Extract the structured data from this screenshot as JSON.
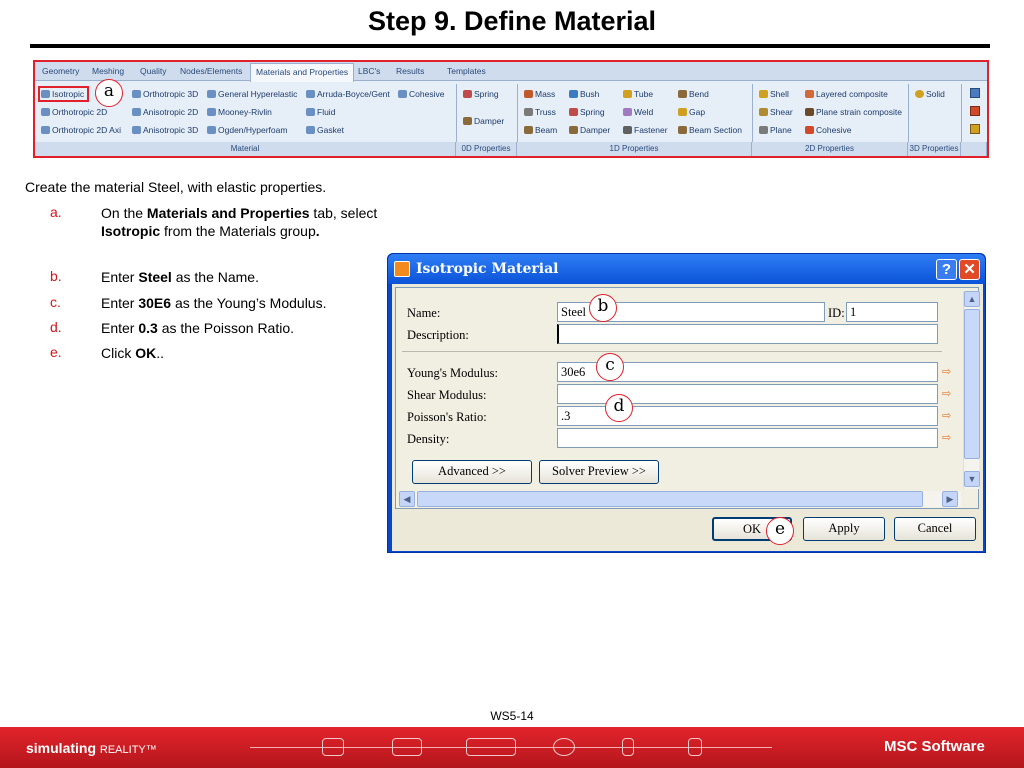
{
  "slide": {
    "title": "Step 9. Define Material",
    "page_number": "WS5-14"
  },
  "ribbon": {
    "tabs": [
      "Geometry",
      "Meshing",
      "Quality",
      "Nodes/Elements",
      "Materials and Properties",
      "LBC's",
      "Results",
      "Templates"
    ],
    "active_tab": "Materials and Properties",
    "material_items": [
      "Isotropic",
      "Orthotropic 2D",
      "Orthotropic 2D Axi",
      "Orthotropic 3D",
      "Anisotropic 2D",
      "Anisotropic 3D",
      "General Hyperelastic",
      "Mooney-Rivlin",
      "Ogden/Hyperfoam",
      "Arruda-Boyce/Gent",
      "Fluid",
      "Gasket",
      "Cohesive"
    ],
    "zero_d_items": [
      "Spring",
      "Damper"
    ],
    "one_d_items": [
      "Mass",
      "Truss",
      "Beam",
      "Bush",
      "Spring",
      "Damper",
      "Tube",
      "Weld",
      "Fastener",
      "Bend",
      "Gap",
      "Beam Section"
    ],
    "two_d_items": [
      "Shell",
      "Shear",
      "Plane",
      "Layered composite",
      "Plane strain composite",
      "Cohesive"
    ],
    "three_d_items": [
      "Solid"
    ],
    "groups": [
      "Material",
      "0D Properties",
      "1D Properties",
      "2D Properties",
      "3D Properties"
    ]
  },
  "instructions": {
    "intro": "Create the material Steel, with elastic properties.",
    "steps": [
      {
        "letter": "a.",
        "pre": "On the ",
        "b1": "Materials and Properties",
        "mid": " tab, select ",
        "b2": "Isotropic",
        "post": " from the Materials group",
        "end": "."
      },
      {
        "letter": "b.",
        "pre": "Enter ",
        "b1": "Steel",
        "post": " as the Name."
      },
      {
        "letter": "c.",
        "pre": "Enter ",
        "b1": "30E6",
        "post": " as the Young’s Modulus."
      },
      {
        "letter": "d.",
        "pre": "Enter ",
        "b1": "0.3",
        "post": " as the Poisson Ratio."
      },
      {
        "letter": "e.",
        "pre": "Click ",
        "b1": "OK",
        "post": ".."
      }
    ]
  },
  "dialog": {
    "title": "Isotropic Material",
    "help": "?",
    "close": "✕",
    "name_label": "Name:",
    "name_value": "Steel",
    "id_label": "ID:",
    "id_value": "1",
    "description_label": "Description:",
    "description_value": "",
    "youngs_label": "Young's Modulus:",
    "youngs_value": "30e6",
    "shear_label": "Shear Modulus:",
    "shear_value": "",
    "poisson_label": "Poisson's Ratio:",
    "poisson_value": ".3",
    "density_label": "Density:",
    "density_value": "",
    "advanced_button": "Advanced >>",
    "solver_preview_button": "Solver Preview >>",
    "ok_button": "OK",
    "apply_button": "Apply",
    "cancel_button": "Cancel"
  },
  "callouts": {
    "a": "a",
    "b": "b",
    "c": "c",
    "d": "d",
    "e": "e"
  },
  "footer": {
    "tagline_bold": "simulating",
    "tagline_rest": "REALITY™",
    "brand": "MSC Software"
  },
  "colors": {
    "accent_red": "#e0202a",
    "step_letter_red": "#d4141c",
    "dialog_blue": "#0a52d8",
    "footer_red": "#c81c22"
  }
}
